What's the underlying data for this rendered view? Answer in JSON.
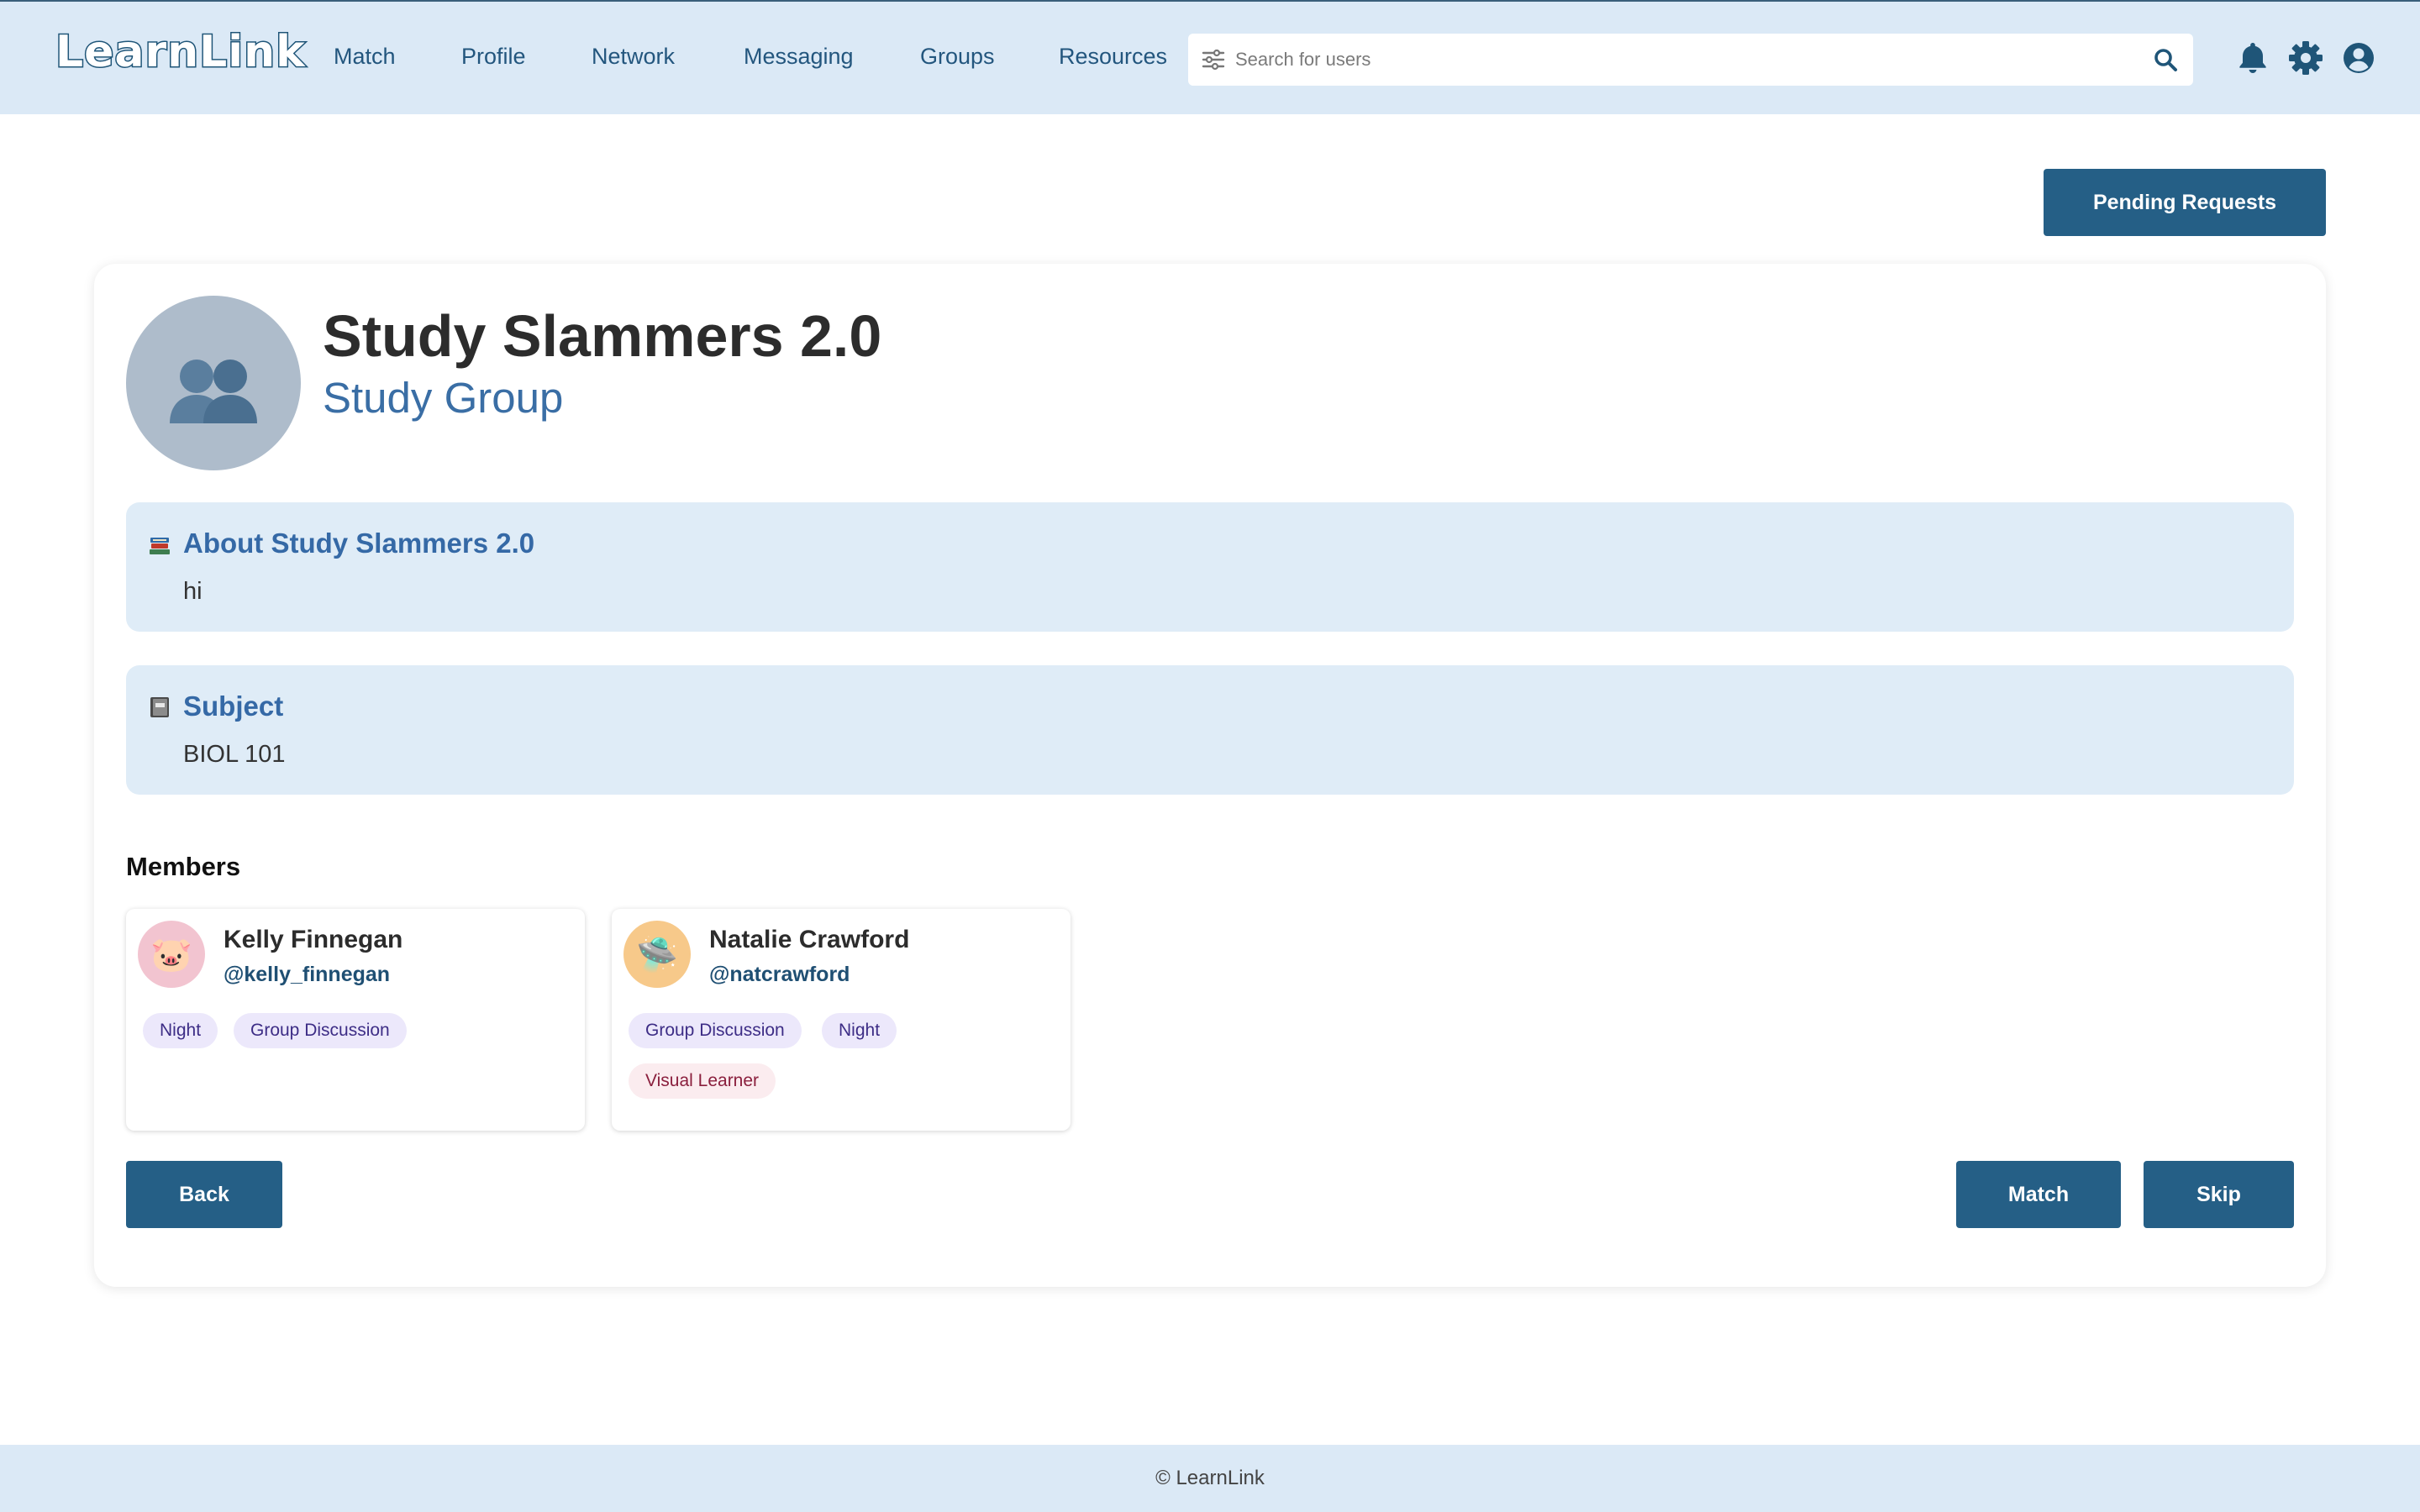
{
  "app": {
    "logo_text": "LearnLink",
    "brand_color": "#255f86",
    "header_bg": "#dbe9f6"
  },
  "nav": {
    "items": [
      "Match",
      "Profile",
      "Network",
      "Messaging",
      "Groups",
      "Resources"
    ]
  },
  "search": {
    "placeholder": "Search for users",
    "value": "",
    "filter_icon": "sliders-icon",
    "submit_icon": "search-icon"
  },
  "header_icons": [
    "bell-icon",
    "gear-icon",
    "user-circle-icon"
  ],
  "pending_requests_label": "Pending Requests",
  "group": {
    "name": "Study Slammers 2.0",
    "type": "Study Group",
    "avatar_icon": "group-silhouette-icon"
  },
  "about": {
    "icon": "books-icon",
    "title": "About Study Slammers 2.0",
    "body": "hi"
  },
  "subject": {
    "icon": "notebook-icon",
    "title": "Subject",
    "body": "BIOL 101"
  },
  "members_title": "Members",
  "members": [
    {
      "name": "Kelly Finnegan",
      "handle": "@kelly_finnegan",
      "avatar_emoji": "🐷",
      "avatar_bg": "#f2c4d0",
      "tags": [
        {
          "label": "Night",
          "tone": "purple"
        },
        {
          "label": "Group Discussion",
          "tone": "purple"
        }
      ]
    },
    {
      "name": "Natalie Crawford",
      "handle": "@natcrawford",
      "avatar_emoji": "🛸",
      "avatar_bg": "#f7c98a",
      "tags": [
        {
          "label": "Group Discussion",
          "tone": "purple"
        },
        {
          "label": "Night",
          "tone": "purple"
        },
        {
          "label": "Visual Learner",
          "tone": "pink"
        }
      ]
    }
  ],
  "actions": {
    "back": "Back",
    "match": "Match",
    "skip": "Skip"
  },
  "footer": {
    "text": "© LearnLink"
  }
}
